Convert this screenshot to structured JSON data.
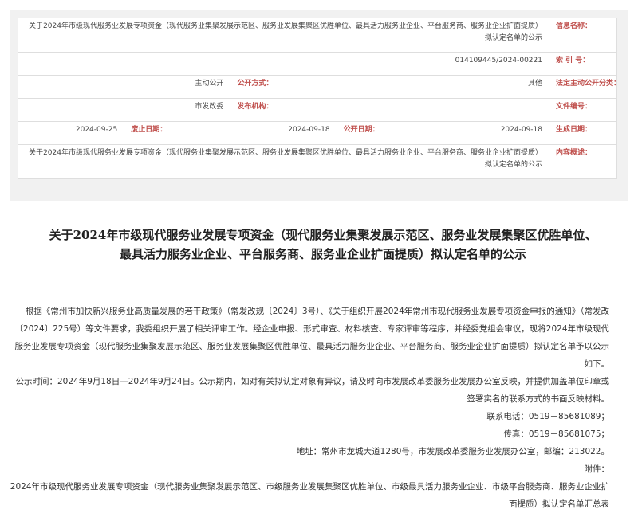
{
  "meta": {
    "info_name_label": "信息名称：",
    "info_name_value": "关于2024年市级现代服务业发展专项资金（现代服务业集聚发展示范区、服务业发展集聚区优胜单位、最具活力服务业企业、平台服务商、服务业企业扩面提质）拟认定名单的公示",
    "index_label": "索 引 号：",
    "index_value": "014109445/2024-00221",
    "category_label": "法定主动公开分类：",
    "category_value": "其他",
    "method_label": "公开方式：",
    "method_value": "主动公开",
    "docno_label": "文件编号：",
    "docno_value": "",
    "issuer_label": "发布机构：",
    "issuer_value": "市发改委",
    "created_label": "生成日期：",
    "created_value": "2024-09-18",
    "published_label": "公开日期：",
    "published_value": "2024-09-18",
    "expire_label": "废止日期：",
    "expire_value": "2024-09-25",
    "summary_label": "内容概述：",
    "summary_value": "关于2024年市级现代服务业发展专项资金（现代服务业集聚发展示范区、服务业发展集聚区优胜单位、最具活力服务业企业、平台服务商、服务业企业扩面提质）拟认定名单的公示"
  },
  "title": "关于2024年市级现代服务业发展专项资金（现代服务业集聚发展示范区、服务业发展集聚区优胜单位、最具活力服务业企业、平台服务商、服务业企业扩面提质）拟认定名单的公示",
  "body": {
    "para1": "根据《常州市加快新兴服务业高质量发展的若干政策》（常发改规〔2024〕3号）、《关于组织开展2024年常州市现代服务业发展专项资金申报的通知》（常发改〔2024〕225号）等文件要求，我委组织开展了相关评审工作。经企业申报、形式审查、材料核查、专家评审等程序，并经委党组会审议，现将2024年市级现代服务业发展专项资金（现代服务业集聚发展示范区、服务业发展集聚区优胜单位、最具活力服务业企业、平台服务商、服务业企业扩面提质）拟认定名单予以公示如下。",
    "para2": "公示时间：2024年9月18日—2024年9月24日。公示期内，如对有关拟认定对象有异议，请及时向市发展改革委服务业发展办公室反映，并提供加盖单位印章或签署实名的联系方式的书面反映材料。",
    "phone": "联系电话：0519－85681089；",
    "fax": "传真：0519－85681075；",
    "address": "地址：常州市龙城大道1280号，市发展改革委服务业发展办公室，邮编：213022。",
    "attach_label": "附件：",
    "attach_item": "2024年市级现代服务业发展专项资金（现代服务业集聚发展示范区、市级服务业发展集聚区优胜单位、市级最具活力服务业企业、市级平台服务商、服务业企业扩面提质）拟认定名单汇总表"
  }
}
